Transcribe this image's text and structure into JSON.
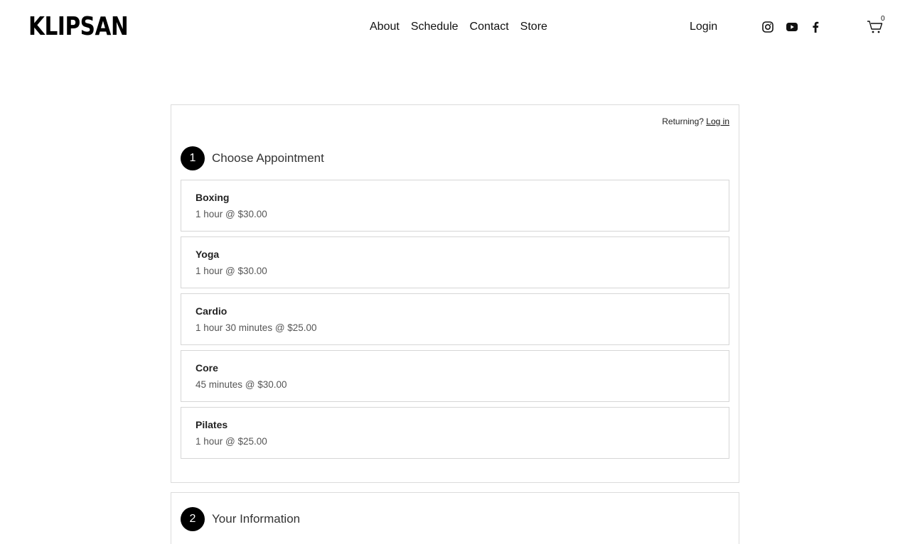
{
  "header": {
    "logo": "KLIPSAN",
    "nav": [
      "About",
      "Schedule",
      "Contact",
      "Store"
    ],
    "login": "Login",
    "social_icons": [
      "instagram-icon",
      "youtube-icon",
      "facebook-icon"
    ],
    "cart_count": "0"
  },
  "scheduler": {
    "returning_text": "Returning?",
    "login_link": "Log in",
    "step1": {
      "number": "1",
      "title": "Choose Appointment"
    },
    "appointments": [
      {
        "name": "Boxing",
        "detail": "1 hour @ $30.00"
      },
      {
        "name": "Yoga",
        "detail": "1 hour @ $30.00"
      },
      {
        "name": "Cardio",
        "detail": "1 hour 30 minutes @ $25.00"
      },
      {
        "name": "Core",
        "detail": "45 minutes @ $30.00"
      },
      {
        "name": "Pilates",
        "detail": "1 hour @ $25.00"
      }
    ],
    "step2": {
      "number": "2",
      "title": "Your Information"
    }
  },
  "colors": {
    "accent": "#000000",
    "border": "#dcdcdc",
    "text": "#1a1a1a",
    "muted": "#555555"
  }
}
